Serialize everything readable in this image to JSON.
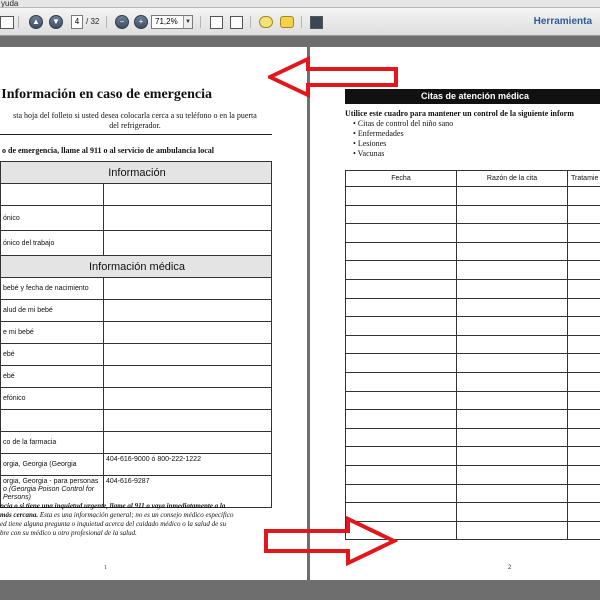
{
  "menubar": {
    "help_label": "yuda"
  },
  "toolbar": {
    "page_current": "4",
    "page_total": "/ 32",
    "zoom_value": "71,2%",
    "tools_label": "Herramienta"
  },
  "left_page": {
    "title": "Información en caso de emergencia",
    "intro_line1": "sta hoja del folleto si usted desea colocarla cerca a su teléfono o en la puerta",
    "intro_line2": "del refrigerador.",
    "emergency_line": "o de emergencia, llame al 911 o al servicio de ambulancia local",
    "section_info": "Información",
    "rows_info": [
      "",
      "ónico",
      "ónico del trabajo"
    ],
    "section_medical": "Información médica",
    "rows_medical": [
      {
        "label": "bebé y fecha de nacimiento",
        "value": ""
      },
      {
        "label": "alud de mi bebé",
        "value": ""
      },
      {
        "label": "e mi bebé",
        "value": ""
      },
      {
        "label": "ebé",
        "value": ""
      },
      {
        "label": "ebé",
        "value": ""
      },
      {
        "label": "efónico",
        "value": ""
      },
      {
        "label": "",
        "value": ""
      },
      {
        "label": "co de la farmacia",
        "value": ""
      },
      {
        "label": "orgia, Georgia (Georgia",
        "value": "404-616-9000 ó  800-222-1222"
      },
      {
        "label": "orgia, Georgia - para personas",
        "label2": "o (Georgia Poison Control for",
        "label3": "Persons)",
        "value": "404-616-9287"
      }
    ],
    "footer_line1": "ncia o si tiene una inquietud urgente, llame al 911 o vaya inmediatamente a la",
    "footer_line2a": "más cercana.",
    "footer_line2b": " Esta es una información general; no es un consejo médico específico",
    "footer_line3": "ed tiene alguna pregunta o inquietud acerca del cuidado médico o la salud de su",
    "footer_line4": "bre con su médico u otro profesional de la salud.",
    "page_number": "1"
  },
  "right_page": {
    "header_bar": "Citas de atención médica",
    "intro": "Utilice este cuadro para mantener un control de la siguiente inform",
    "bullets": [
      "Citas de control del niño sano",
      "Enfermedades",
      "Lesiones",
      "Vacunas"
    ],
    "columns": [
      "Fecha",
      "Razón de la cita",
      "Tratamie"
    ],
    "page_number": "2"
  },
  "colors": {
    "arrow_red": "#e3161b",
    "workspace_gray": "#6e6e6e",
    "tools_blue": "#2d5a9c"
  }
}
